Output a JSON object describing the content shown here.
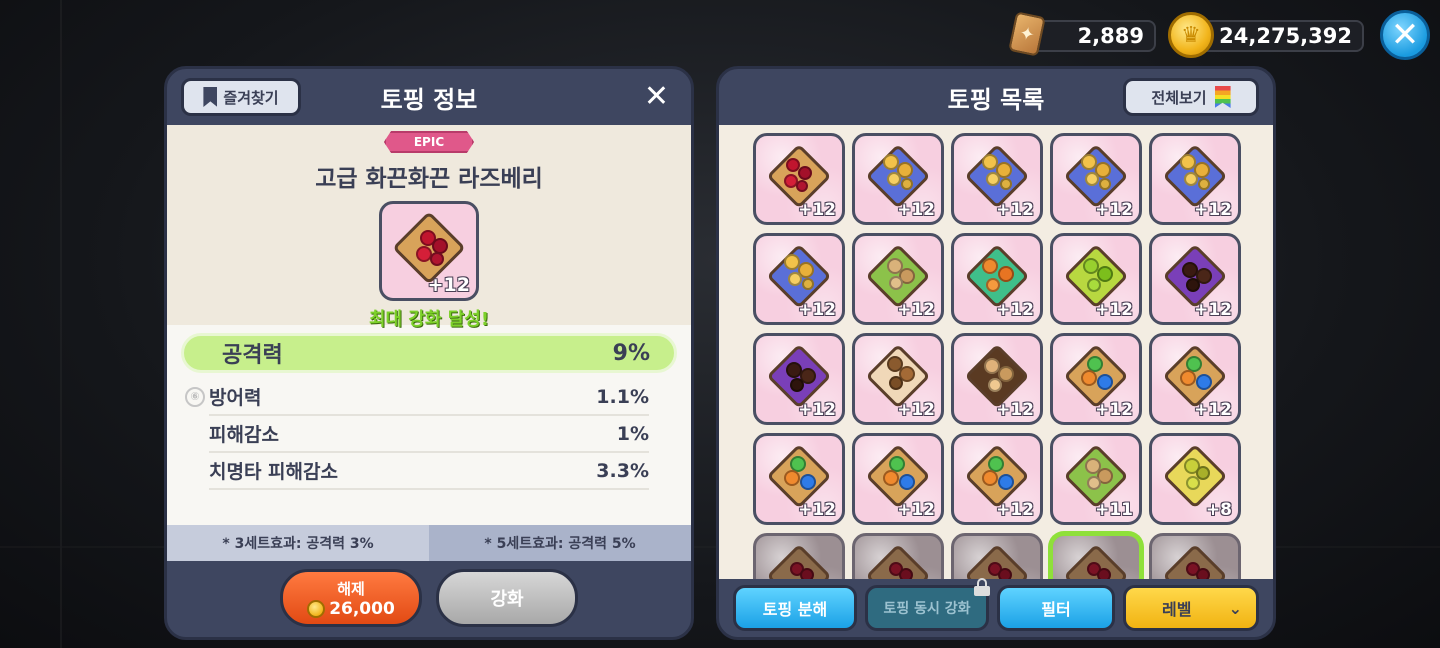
{
  "currency": {
    "crystals": "2,889",
    "coins": "24,275,392"
  },
  "left_panel": {
    "title": "토핑 정보",
    "favorite_label": "즐겨찾기",
    "rarity": "EPIC",
    "topping_name": "고급 화끈화끈 라즈베리",
    "topping_level": "+12",
    "max_status": "최대 강화 달성!",
    "main_stat": {
      "label": "공격력",
      "value": "9%"
    },
    "sub_stats": [
      {
        "label": "방어력",
        "value": "1.1%"
      },
      {
        "label": "피해감소",
        "value": "1%"
      },
      {
        "label": "치명타 피해감소",
        "value": "3.3%"
      }
    ],
    "set_effects": [
      "* 3세트효과: 공격력 3%",
      "* 5세트효과: 공격력 5%"
    ],
    "release_label": "해제",
    "release_cost": "26,000",
    "enhance_label": "강화"
  },
  "right_panel": {
    "title": "토핑 목록",
    "view_all_label": "전체보기",
    "toppings": [
      {
        "kind": "raspberry",
        "level": "+12"
      },
      {
        "kind": "caramel",
        "level": "+12"
      },
      {
        "kind": "caramel",
        "level": "+12"
      },
      {
        "kind": "caramel",
        "level": "+12"
      },
      {
        "kind": "caramel",
        "level": "+12"
      },
      {
        "kind": "caramel",
        "level": "+12"
      },
      {
        "kind": "almond",
        "level": "+12"
      },
      {
        "kind": "apple-jelly",
        "level": "+12"
      },
      {
        "kind": "peach",
        "level": "+12"
      },
      {
        "kind": "choco",
        "level": "+12"
      },
      {
        "kind": "choco",
        "level": "+12"
      },
      {
        "kind": "almond-brown",
        "level": "+12"
      },
      {
        "kind": "hazelnut",
        "level": "+12"
      },
      {
        "kind": "candy",
        "level": "+12"
      },
      {
        "kind": "candy",
        "level": "+12"
      },
      {
        "kind": "candy",
        "level": "+12"
      },
      {
        "kind": "candy",
        "level": "+12"
      },
      {
        "kind": "candy",
        "level": "+12"
      },
      {
        "kind": "almond",
        "level": "+11"
      },
      {
        "kind": "walnut",
        "level": "+8"
      },
      {
        "kind": "raspberry-faded",
        "level": ""
      },
      {
        "kind": "raspberry-faded",
        "level": ""
      },
      {
        "kind": "raspberry-faded",
        "level": ""
      },
      {
        "kind": "raspberry-selected",
        "level": ""
      },
      {
        "kind": "raspberry-faded",
        "level": ""
      }
    ],
    "buttons": {
      "decompose": "토핑 분해",
      "simultaneous": "토핑 동시 강화",
      "filter": "필터",
      "sort": "레벨"
    }
  },
  "colors": {
    "panel_bg": "#3e4660",
    "main_stat_bg": "#c7ef8c",
    "release_btn": "#f25c22",
    "blue_btn": "#1ba1e6",
    "sort_btn": "#f1b312"
  }
}
